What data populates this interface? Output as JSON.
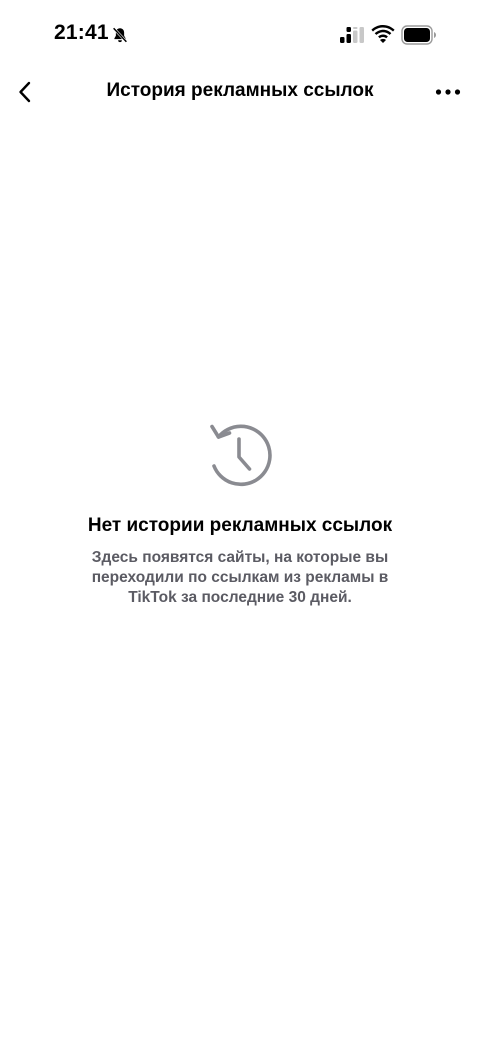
{
  "status_bar": {
    "time": "21:41",
    "icons": [
      "bell-off-icon",
      "signal-icon",
      "wifi-icon",
      "battery-icon"
    ]
  },
  "nav": {
    "title": "История рекламных ссылок",
    "back_icon": "chevron-left-icon",
    "more_icon": "more-horizontal-icon"
  },
  "empty_state": {
    "icon": "history-icon",
    "title": "Нет истории рекламных ссылок",
    "description": "Здесь появятся сайты, на которые вы переходили по ссылкам из рекламы в TikTok за последние 30 дней."
  },
  "colors": {
    "background": "#ffffff",
    "text_primary": "#000000",
    "text_secondary": "#5b5b63",
    "icon_gray": "#8a8b91"
  }
}
